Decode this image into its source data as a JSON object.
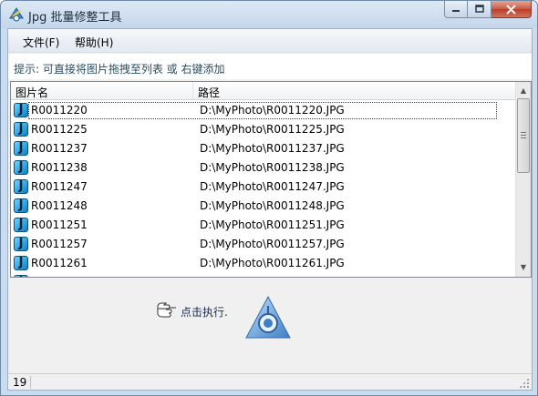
{
  "window": {
    "title": "Jpg 批量修整工具",
    "close_color": "#c75b46"
  },
  "menu": {
    "file": "文件(F)",
    "help": "帮助(H)"
  },
  "hint": "提示: 可直接将图片拖拽至列表 或 右键添加",
  "list": {
    "columns": [
      "图片名",
      "路径"
    ],
    "icon": "jpg-file-icon",
    "rows": [
      {
        "name": "R0011220",
        "path": "D:\\MyPhoto\\R0011220.JPG"
      },
      {
        "name": "R0011225",
        "path": "D:\\MyPhoto\\R0011225.JPG"
      },
      {
        "name": "R0011237",
        "path": "D:\\MyPhoto\\R0011237.JPG"
      },
      {
        "name": "R0011238",
        "path": "D:\\MyPhoto\\R0011238.JPG"
      },
      {
        "name": "R0011247",
        "path": "D:\\MyPhoto\\R0011247.JPG"
      },
      {
        "name": "R0011248",
        "path": "D:\\MyPhoto\\R0011248.JPG"
      },
      {
        "name": "R0011251",
        "path": "D:\\MyPhoto\\R0011251.JPG"
      },
      {
        "name": "R0011257",
        "path": "D:\\MyPhoto\\R0011257.JPG"
      },
      {
        "name": "R0011261",
        "path": "D:\\MyPhoto\\R0011261.JPG"
      },
      {
        "name": "",
        "path": ""
      }
    ],
    "focused_index": 0
  },
  "action": {
    "label": "点击执行.",
    "hand_icon": "pointing-hand-icon",
    "logo_icon": "app-logo-icon"
  },
  "status": {
    "count": "19"
  }
}
